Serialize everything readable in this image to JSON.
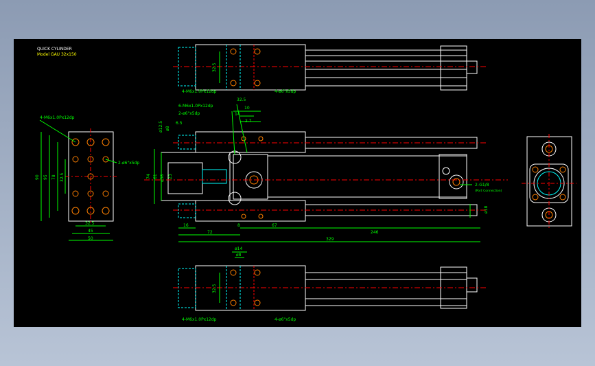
{
  "drawing": {
    "title_line1": "QUICK CYLINDER",
    "title_line2": "Model GAU 32x150",
    "colors": {
      "background": "#000000",
      "outline": "#ffffff",
      "dimension": "#00ff00",
      "centerline": "#ff0000",
      "hidden": "#00ffff",
      "hole": "#ff8000",
      "title": "#ffff00"
    }
  },
  "top_view": {
    "callout_left": "4-M6x1.0Px12dp",
    "callout_right": "4-ø6\"x5dp",
    "dim_vertical": "32.5"
  },
  "bottom_view": {
    "callout_left": "4-M6x1.0Px12dp",
    "callout_right": "4-ø6\"x5dp",
    "dim_vertical": "32.5",
    "dim_top_a": "ø14",
    "dim_top_b": "ø8"
  },
  "left_view": {
    "callout_top": "4-M6x1.0Px12dp",
    "callout_right": "2-ø6\"x5dp",
    "dim_90": "90",
    "dim_95": "95",
    "dim_78": "78",
    "dim_325v": "32.5",
    "dim_325h": "32.5",
    "dim_45": "45",
    "dim_50": "50"
  },
  "main_view": {
    "callout_a": "6-M6x1.0Px12dp",
    "callout_b": "2-ø6\"x5dp",
    "callout_port": "2-G1/8",
    "callout_port_sub": "(Port Connection)",
    "dim_325": "32.5",
    "dim_10": "10",
    "dim_14": "14",
    "dim_27": "2.7",
    "dim_65": "6.5",
    "dim_phi8": "ø8",
    "dim_phi12": "ø12.5",
    "dim_74": "74",
    "dim_61": "61",
    "dim_phi58": "ø58",
    "dim_23": "23",
    "dim_16": "16",
    "dim_8": "8",
    "dim_67": "67",
    "dim_72": "72",
    "dim_246": "246",
    "dim_329": "329",
    "dim_phi18": "ø18"
  }
}
